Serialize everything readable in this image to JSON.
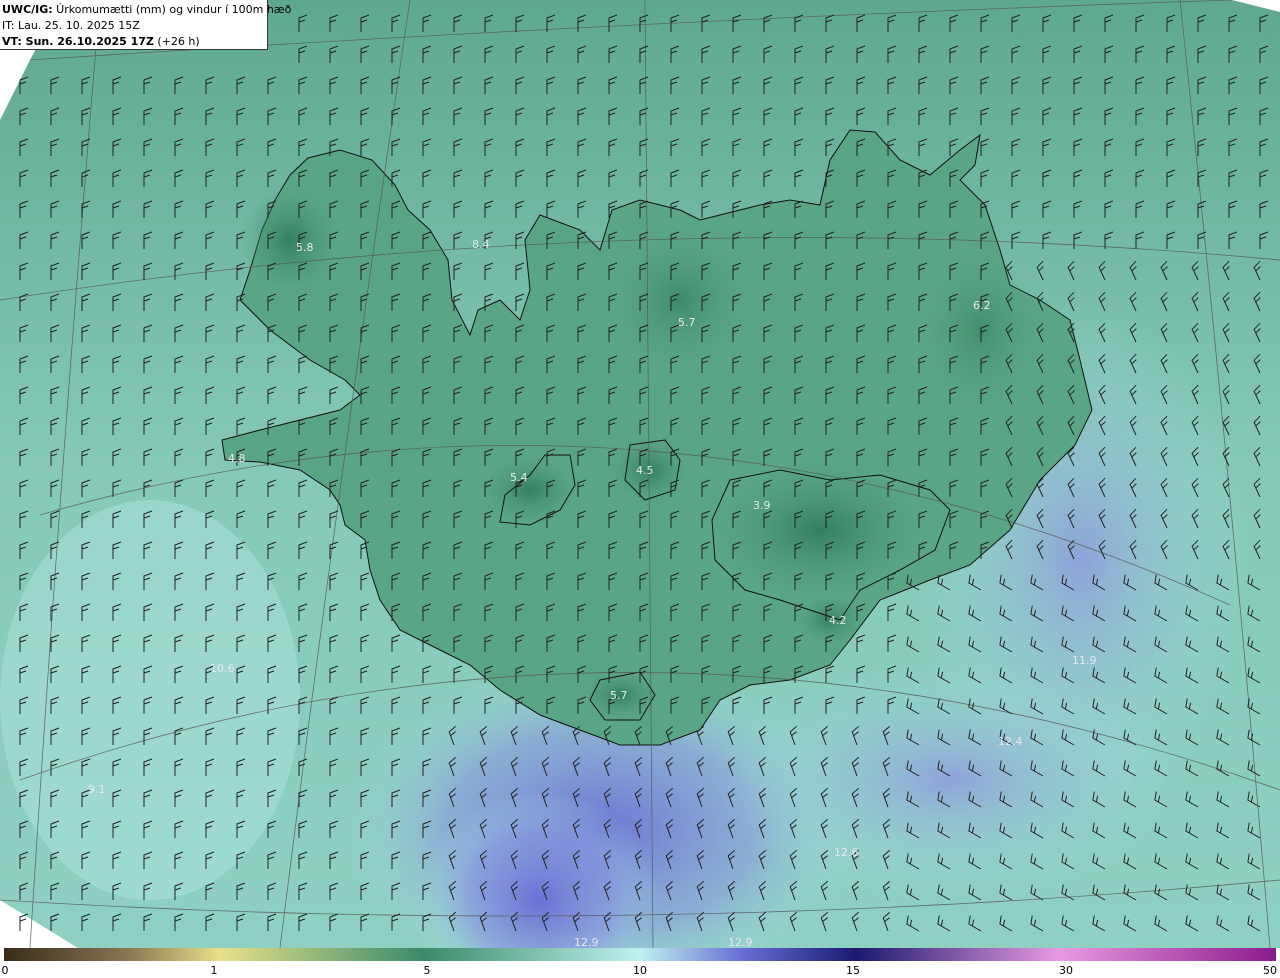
{
  "header": {
    "line1_bold": "UWC/IG:",
    "line1_rest": " Úrkomumætti (mm) og vindur í 100m hæð",
    "line2": "IT: Lau. 25. 10. 2025 15Z",
    "line3_bold": "VT: Sun. 26.10.2025 17Z",
    "line3_rest": " (+26 h)"
  },
  "colorbar": {
    "ticks": [
      "0",
      "1",
      "5",
      "10",
      "15",
      "30",
      "50"
    ],
    "colors": [
      "#3a2a1a",
      "#8a7a55",
      "#e7e08a",
      "#3a8a6a",
      "#bff2ee",
      "#4f4fb8",
      "#1a1a6e",
      "#e89be0",
      "#8a1a8a"
    ]
  },
  "map_labels": [
    {
      "text": "5.8"
    },
    {
      "text": "8.4"
    },
    {
      "text": "5.7"
    },
    {
      "text": "6.2"
    },
    {
      "text": "4.8"
    },
    {
      "text": "5.4"
    },
    {
      "text": "4.5"
    },
    {
      "text": "3.9"
    },
    {
      "text": "4.2"
    },
    {
      "text": "10.6"
    },
    {
      "text": "5.7"
    },
    {
      "text": "11.9"
    },
    {
      "text": "12.4"
    },
    {
      "text": "12.6"
    },
    {
      "text": "9.1"
    },
    {
      "text": "12.9"
    },
    {
      "text": "12.9"
    }
  ],
  "colors": {
    "ocean_low": "#7ec6b4",
    "land": "#4f9a7a",
    "land_dark": "#2f7a5a",
    "ocean_high": "#7b80d6",
    "outline": "#1a1a1a"
  }
}
